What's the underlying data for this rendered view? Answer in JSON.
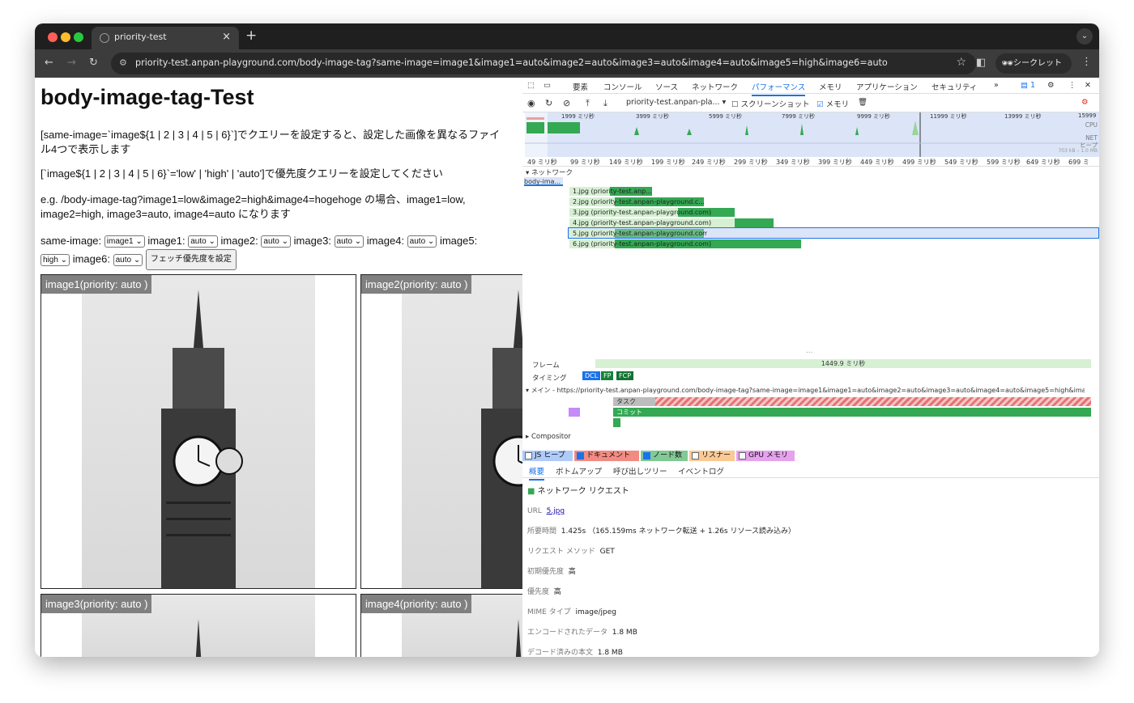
{
  "browser": {
    "tab_title": "priority-test",
    "url": "priority-test.anpan-playground.com/body-image-tag?same-image=image1&image1=auto&image2=auto&image3=auto&image4=auto&image5=high&image6=auto",
    "incognito_label": "シークレット",
    "new_tab": "+",
    "close": "×"
  },
  "page": {
    "title": "body-image-tag-Test",
    "para1": "[same-image=`image${1 | 2 | 3 | 4 | 5 | 6}`]でクエリーを設定すると、設定した画像を異なるファイル4つで表示します",
    "para2": "[`image${1 | 2 | 3 | 4 | 5 | 6}`='low' | 'high' | 'auto']で優先度クエリーを設定してください",
    "para3": "e.g. /body-image-tag?image1=low&image2=high&image4=hogehoge の場合、image1=low, image2=high, image3=auto, image4=auto になります",
    "controls": {
      "same_image_label": "same-image:",
      "same_image_value": "image1",
      "image1_label": "image1:",
      "image1_value": "auto",
      "image2_label": "image2:",
      "image2_value": "auto",
      "image3_label": "image3:",
      "image3_value": "auto",
      "image4_label": "image4:",
      "image4_value": "auto",
      "image5_label": "image5:",
      "image5_value": "high",
      "image6_label": "image6:",
      "image6_value": "auto",
      "submit_label": "フェッチ優先度を設定"
    },
    "cards": [
      {
        "label": "image1(priority: auto )"
      },
      {
        "label": "image2(priority: auto )"
      },
      {
        "label": "image3(priority: auto )"
      },
      {
        "label": "image4(priority: auto )"
      }
    ]
  },
  "devtools": {
    "tabs": [
      "要素",
      "コンソール",
      "ソース",
      "ネットワーク",
      "パフォーマンス",
      "メモリ",
      "アプリケーション",
      "セキュリティ",
      "»"
    ],
    "active_tab": "パフォーマンス",
    "issues_count": "1",
    "recording_select": "priority-test.anpan-pla...",
    "screenshot_label": "スクリーンショット",
    "memory_label": "メモリ",
    "overview_ticks": [
      "1999 ミリ秒",
      "3999 ミリ秒",
      "5999 ミリ秒",
      "7999 ミリ秒",
      "9999 ミリ秒",
      "11999 ミリ秒",
      "13999 ミリ秒",
      "15999"
    ],
    "overview_labels": {
      "cpu": "CPU",
      "net": "NET",
      "heap": "ヒープ",
      "heap_range": "703 kB – 1.0 MB"
    },
    "ruler_ticks": [
      "49 ミリ秒",
      "99 ミリ秒",
      "149 ミリ秒",
      "199 ミリ秒",
      "249 ミリ秒",
      "299 ミリ秒",
      "349 ミリ秒",
      "399 ミリ秒",
      "449 ミリ秒",
      "499 ミリ秒",
      "549 ミリ秒",
      "599 ミリ秒",
      "649 ミリ秒",
      "699 ミ"
    ],
    "network_track": "ネットワーク",
    "doc_request": "body-ima...",
    "requests": [
      {
        "label": "1.jpg (priority-test.anp..."
      },
      {
        "label": "2.jpg (priority-test.anpan-playground.c..."
      },
      {
        "label": "3.jpg (priority-test.anpan-playground.com)"
      },
      {
        "label": "4.jpg (priority-test.anpan-playground.com)"
      },
      {
        "label": "5.jpg (priority-test.anpan-playground.com)"
      },
      {
        "label": "6.jpg (priority-test.anpan-playground.com)"
      }
    ],
    "frames_label": "フレーム",
    "frame_time": "1449.9 ミリ秒",
    "timings_label": "タイミング",
    "marks": [
      "DCL",
      "FP",
      "FCP"
    ],
    "main_label": "メイン - https://priority-test.anpan-playground.com/body-image-tag?same-image=image1&image1=auto&image2=auto&image3=auto&image4=auto&image5=high&image6=auto",
    "task_label": "タスク",
    "commit_label": "コミット",
    "compositor_label": "Compositor",
    "legend": [
      {
        "label": "JS ヒープ",
        "checked": false
      },
      {
        "label": "ドキュメント",
        "checked": true
      },
      {
        "label": "ノード数",
        "checked": true
      },
      {
        "label": "リスナー",
        "checked": false
      },
      {
        "label": "GPU メモリ",
        "checked": false
      }
    ],
    "summary_tabs": [
      "概要",
      "ボトムアップ",
      "呼び出しツリー",
      "イベントログ"
    ],
    "summary": {
      "heading": "ネットワーク リクエスト",
      "url_key": "URL",
      "url_val": "5.jpg",
      "duration_key": "所要時間",
      "duration_val": "1.425s （165.159ms ネットワーク転送 + 1.26s リソース読み込み）",
      "method_key": "リクエスト メソッド",
      "method_val": "GET",
      "initial_priority_key": "初期優先度",
      "initial_priority_val": "高",
      "priority_key": "優先度",
      "priority_val": "高",
      "mime_key": "MIME タイプ",
      "mime_val": "image/jpeg",
      "encoded_key": "エンコードされたデータ",
      "encoded_val": "1.8 MB",
      "decoded_key": "デコード済みの本文",
      "decoded_val": "1.8 MB"
    }
  }
}
